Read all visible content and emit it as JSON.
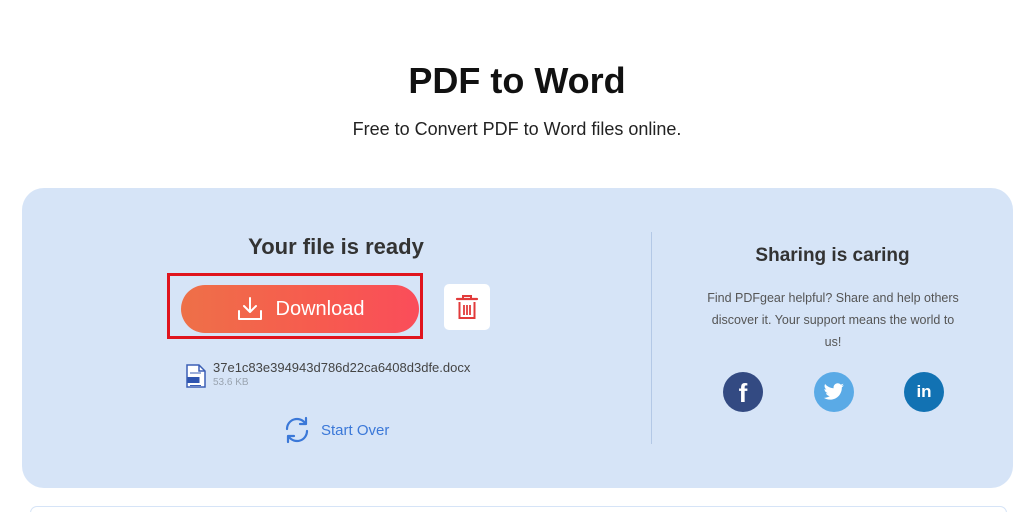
{
  "header": {
    "title": "PDF to Word",
    "subtitle": "Free to Convert PDF to Word files online."
  },
  "result": {
    "title": "Your file is ready",
    "download_label": "Download",
    "file_name": "37e1c83e394943d786d22ca6408d3dfe.docx",
    "file_size": "53.6 KB",
    "start_over_label": "Start Over"
  },
  "share": {
    "title": "Sharing is caring",
    "text": "Find PDFgear helpful? Share and help others discover it. Your support means the world to us!",
    "icons": [
      "facebook-icon",
      "twitter-icon",
      "linkedin-icon"
    ]
  },
  "colors": {
    "panel_bg": "#d6e4f7",
    "download_gradient_start": "#ee7048",
    "download_gradient_end": "#fa4d5a",
    "highlight": "#e0141e",
    "link": "#3b78d8",
    "facebook": "#334a82",
    "twitter": "#5aaae6",
    "linkedin": "#1272b3"
  }
}
